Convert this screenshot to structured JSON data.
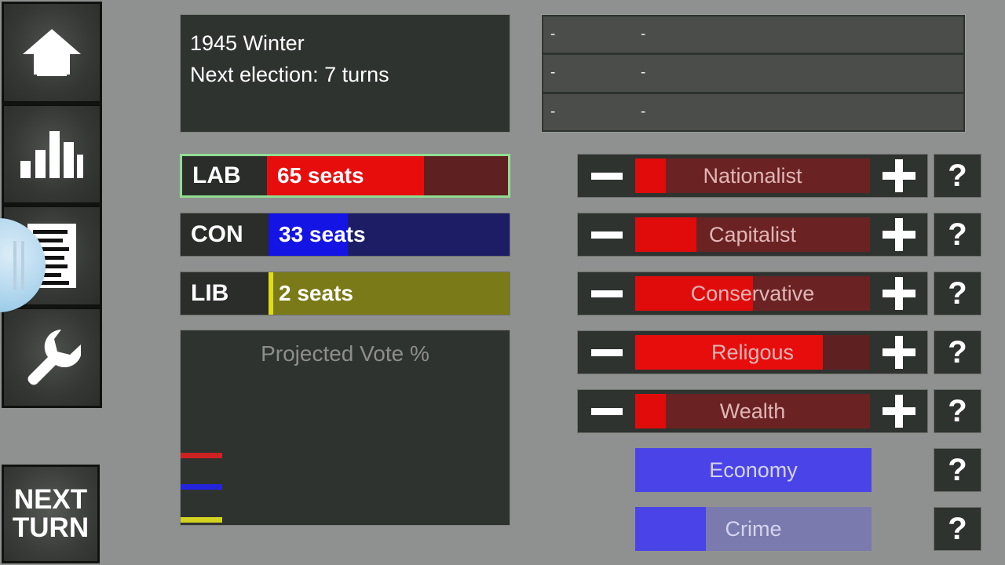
{
  "background_color": "#8f9190",
  "panel_color": "#2f3330",
  "sidebar": {
    "items": [
      {
        "name": "home",
        "icon": "house-icon"
      },
      {
        "name": "statistics",
        "icon": "bar-chart-icon"
      },
      {
        "name": "documents",
        "icon": "document-icon"
      },
      {
        "name": "settings",
        "icon": "wrench-icon"
      }
    ],
    "next_turn": {
      "line1": "NEXT",
      "line2": "TURN"
    }
  },
  "date_panel": {
    "line1": "1945 Winter",
    "line2": "Next election: 7 turns"
  },
  "event_panel": {
    "rows": [
      {
        "col_a": "-",
        "col_b": "-"
      },
      {
        "col_a": "-",
        "col_b": "-"
      },
      {
        "col_a": "-",
        "col_b": "-"
      }
    ]
  },
  "parties": [
    {
      "abbr": "LAB",
      "seats_label": "65 seats",
      "seats": 65,
      "fill_pct": 65,
      "fill_color": "#e80d0d",
      "track_color": "#5e2020",
      "selected": true,
      "highlight_color": "#90dd90"
    },
    {
      "abbr": "CON",
      "seats_label": "33 seats",
      "seats": 33,
      "fill_pct": 33,
      "fill_color": "#1414e4",
      "track_color": "#1d1d66",
      "selected": false,
      "highlight_color": "#90dd90"
    },
    {
      "abbr": "LIB",
      "seats_label": "2 seats",
      "seats": 2,
      "fill_pct": 2,
      "fill_color": "#dede14",
      "track_color": "#7a7a18",
      "selected": false,
      "highlight_color": "#90dd90"
    }
  ],
  "chart_data": {
    "type": "line",
    "title": "Projected Vote %",
    "xlabel": "",
    "ylabel": "",
    "grid": false,
    "legend": "none",
    "x": [
      0
    ],
    "ylim": [
      0,
      100
    ],
    "series": [
      {
        "name": "LAB",
        "color": "#cc2222",
        "values": [
          48
        ]
      },
      {
        "name": "CON",
        "color": "#2424dd",
        "values": [
          26
        ]
      },
      {
        "name": "LIB",
        "color": "#d4d420",
        "values": [
          3
        ]
      }
    ]
  },
  "policies": [
    {
      "label": "Nationalist",
      "fill_pct": 13,
      "fill_color": "#e00c0c",
      "track_color": "#6b2222",
      "minus_label": "—",
      "plus_label": "+",
      "help_label": "?"
    },
    {
      "label": "Capitalist",
      "fill_pct": 26,
      "fill_color": "#e00c0c",
      "track_color": "#6b2222",
      "minus_label": "—",
      "plus_label": "+",
      "help_label": "?"
    },
    {
      "label": "Conservative",
      "fill_pct": 50,
      "fill_color": "#e00c0c",
      "track_color": "#6b2222",
      "minus_label": "—",
      "plus_label": "+",
      "help_label": "?"
    },
    {
      "label": "Religous",
      "fill_pct": 80,
      "fill_color": "#e80d0d",
      "track_color": "#5e2020",
      "minus_label": "—",
      "plus_label": "+",
      "help_label": "?"
    },
    {
      "label": "Wealth",
      "fill_pct": 13,
      "fill_color": "#e00c0c",
      "track_color": "#6b2222",
      "minus_label": "—",
      "plus_label": "+",
      "help_label": "?"
    }
  ],
  "stats": [
    {
      "label": "Economy",
      "fill_pct": 100,
      "fill_color": "#4a44e8",
      "track_color": "#7a7aae",
      "help_label": "?"
    },
    {
      "label": "Crime",
      "fill_pct": 30,
      "fill_color": "#4a44e8",
      "track_color": "#7a7aae",
      "help_label": "?"
    }
  ]
}
